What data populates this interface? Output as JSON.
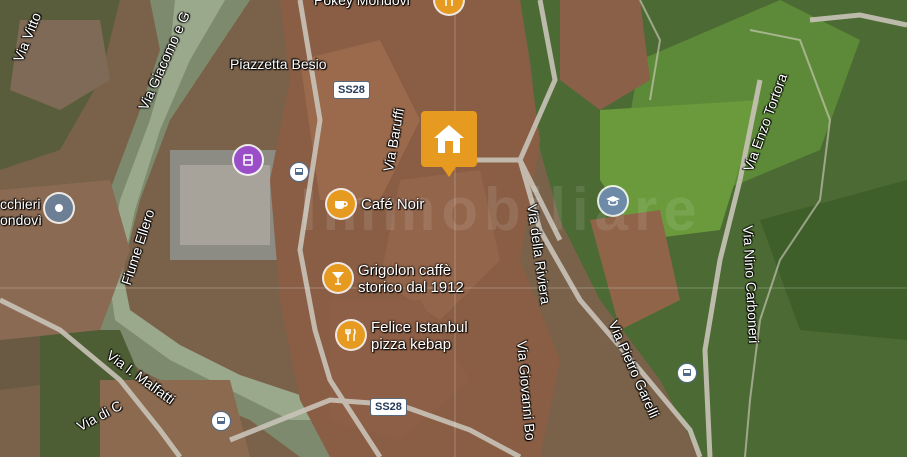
{
  "map": {
    "type": "satellite",
    "colors": {
      "accent_home": "#e69a1f",
      "poi_food": "#e69a1f",
      "poi_shop": "#9a4fc8",
      "poi_school": "#6d8aa8",
      "poi_place": "#6d7f94"
    }
  },
  "labels": {
    "piazzetta": "Piazzetta Besio",
    "pokey": "Pokey Mondovi",
    "via_vittorio": "Via Vitto",
    "via_giacomo": "Via Giacomo e G",
    "via_baruffi": "Via Baruffi",
    "fiume_ellero": "Fiume Ellero",
    "via_della_riviera": "Via della Riviera",
    "via_giovanni_bo": "Via Giovanni Bo",
    "via_pietro_garelli": "Via Pietro Garelli",
    "via_enzo_tortora": "Via Enzo Tortora",
    "via_nino_carboneri": "Via Nino Carboneri",
    "via_malfatti": "Via I. Malfatti",
    "via_di": "Via di C",
    "cchieri_line1": "cchieri",
    "cchieri_line2": "ondovì"
  },
  "shields": {
    "ss28_top": "SS28",
    "ss28_bottom": "SS28"
  },
  "pois": {
    "cafe_noir": "Café Noir",
    "grigolon_line1": "Grigolon caffè",
    "grigolon_line2": "storico dal 1912",
    "felice_line1": "Felice Istanbul",
    "felice_line2": "pizza kebap"
  },
  "watermark": "Immobiliare"
}
